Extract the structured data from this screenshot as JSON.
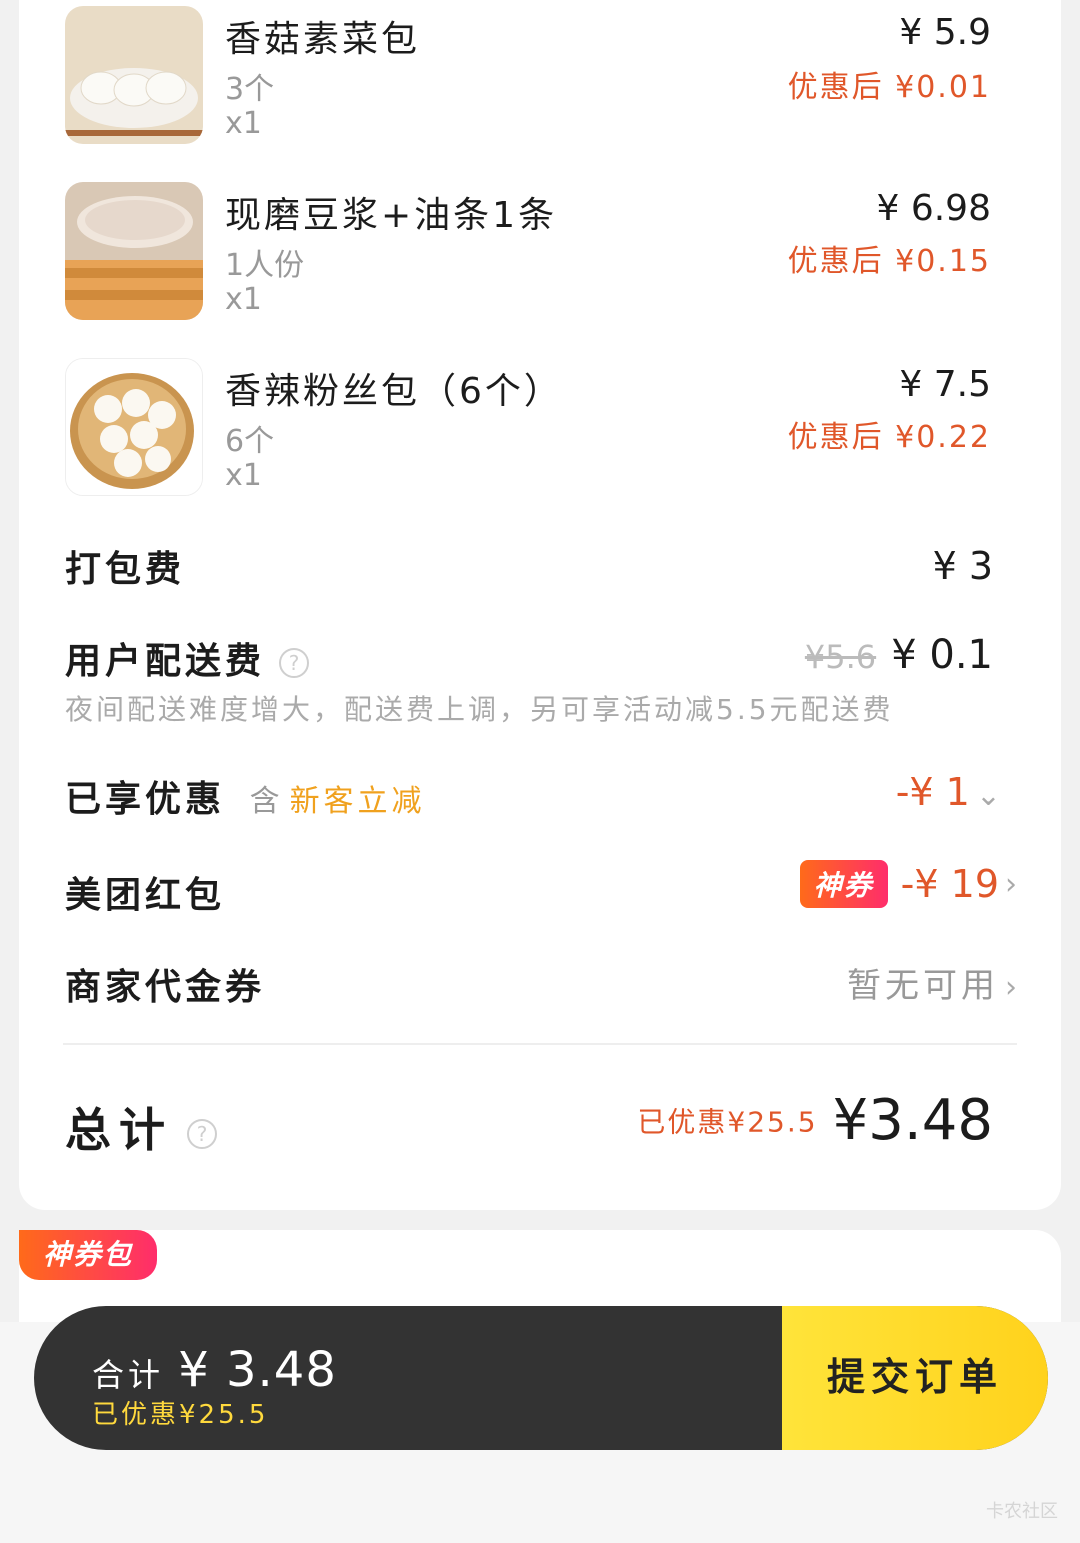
{
  "items": [
    {
      "name": "香菇素菜包",
      "spec": "3个",
      "qty": "x1",
      "price": "¥ 5.9",
      "discounted": "优惠后 ¥0.01",
      "image_icon": "steamed-bun-plate-icon"
    },
    {
      "name": "现磨豆浆+油条1条",
      "spec": "1人份",
      "qty": "x1",
      "price": "¥ 6.98",
      "discounted": "优惠后 ¥0.15",
      "image_icon": "soymilk-youtiao-icon"
    },
    {
      "name": "香辣粉丝包（6个）",
      "spec": "6个",
      "qty": "x1",
      "price": "¥ 7.5",
      "discounted": "优惠后 ¥0.22",
      "image_icon": "bun-basket-icon"
    }
  ],
  "packing": {
    "label": "打包费",
    "value": "¥ 3"
  },
  "delivery": {
    "label": "用户配送费",
    "original": "¥5.6",
    "value": "¥ 0.1",
    "note": "夜间配送难度增大，配送费上调，另可享活动减5.5元配送费"
  },
  "enjoyed": {
    "label": "已享优惠",
    "prefix": "含",
    "detail": "新客立减",
    "value": "-¥ 1"
  },
  "redpacket": {
    "label": "美团红包",
    "badge": "神券",
    "value": "-¥ 19"
  },
  "merchant_coupon": {
    "label": "商家代金券",
    "value": "暂无可用"
  },
  "total": {
    "label": "总计",
    "saved": "已优惠¥25.5",
    "value": "¥3.48"
  },
  "coupon_pack": {
    "label": "神券包"
  },
  "bottom_bar": {
    "sum_label": "合计",
    "sum_value": "¥ 3.48",
    "saved": "已优惠¥25.5",
    "submit": "提交订单"
  },
  "watermark": "卡农社区",
  "colors": {
    "discount": "#e0572a",
    "accent_orange": "#f0a11e",
    "submit_yellow": "#ffd21c",
    "bar_dark": "#333333"
  }
}
